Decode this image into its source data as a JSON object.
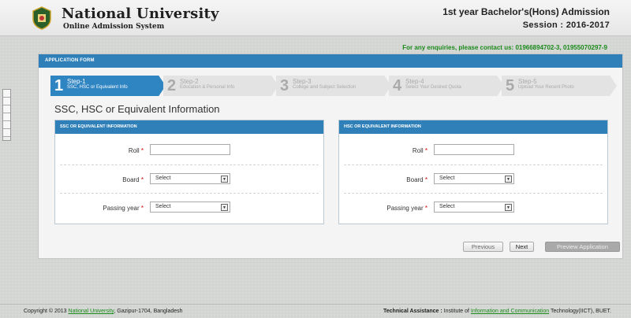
{
  "header": {
    "university": "National University",
    "subtitle": "Online Admission System",
    "admission_title": "1st year Bachelor's(Hons) Admission",
    "session": "Session : 2016-2017"
  },
  "enquiry": {
    "text": "For any enquiries, please contact us:",
    "phones": "01966894702-3, 01955070297-9"
  },
  "form": {
    "header": "APPLICATION FORM",
    "steps": [
      {
        "num": "1",
        "label": "Step-1",
        "desc": "SSC, HSC or Equivalent Info"
      },
      {
        "num": "2",
        "label": "Step-2",
        "desc": "Education & Personal Info"
      },
      {
        "num": "3",
        "label": "Step-3",
        "desc": "College and Subject Selection"
      },
      {
        "num": "4",
        "label": "Step-4",
        "desc": "Select Your Desired Quota"
      },
      {
        "num": "5",
        "label": "Step-5",
        "desc": "Upload Your Recent Photo"
      }
    ],
    "section_title": "SSC, HSC or Equivalent Information",
    "ssc": {
      "heading": "SSC OR EQUIVALENT INFORMATION",
      "roll_label": "Roll",
      "roll_value": "",
      "board_label": "Board",
      "board_value": "Select",
      "year_label": "Passing year",
      "year_value": "Select"
    },
    "hsc": {
      "heading": "HSC OR EQUIVALENT INFORMATION",
      "roll_label": "Roll",
      "roll_value": "",
      "board_label": "Board",
      "board_value": "Select",
      "year_label": "Passing year",
      "year_value": "Select"
    },
    "required_mark": "*",
    "buttons": {
      "previous": "Previous",
      "next": "Next",
      "preview": "Preview Application"
    }
  },
  "footer": {
    "copyright_prefix": "Copyright © 2013",
    "university_link": "National University",
    "copyright_suffix": ", Gazipur-1704, Bangladesh",
    "tech_label": "Technical Assistance :",
    "tech_prefix": "Institute of",
    "tech_link": "Information and Communication",
    "tech_suffix": "Technology(IICT), BUET."
  },
  "colors": {
    "accent": "#2f7fb8",
    "enquiry_green": "#1a8a1a",
    "required_red": "#cc0000"
  }
}
